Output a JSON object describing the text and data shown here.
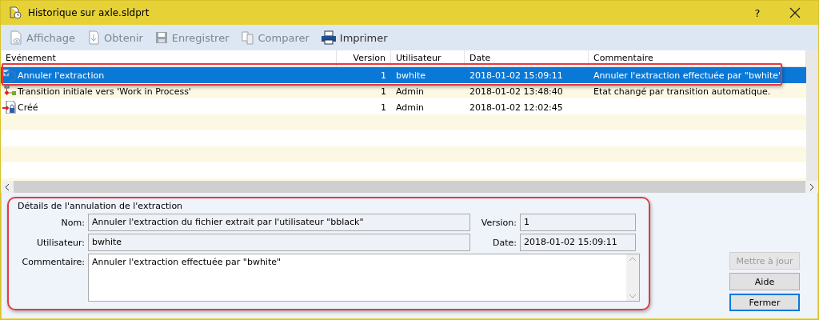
{
  "window": {
    "title": "Historique sur axle.sldprt",
    "help": "?"
  },
  "toolbar": [
    {
      "label": "Affichage",
      "kind": "view",
      "disabled": true
    },
    {
      "label": "Obtenir",
      "kind": "get",
      "disabled": true
    },
    {
      "label": "Enregistrer",
      "kind": "save",
      "disabled": true
    },
    {
      "label": "Comparer",
      "kind": "compare",
      "disabled": true
    },
    {
      "label": "Imprimer",
      "kind": "print",
      "disabled": false
    }
  ],
  "table": {
    "columns": [
      "Evénement",
      "Version",
      "Utilisateur",
      "Date",
      "Commentaire"
    ],
    "rows": [
      {
        "kind": "undo",
        "event": "Annuler l'extraction",
        "version": "1",
        "user": "bwhite",
        "date": "2018-01-02 15:09:11",
        "comment": "Annuler l'extraction effectuée par \"bwhite\"",
        "selected": true
      },
      {
        "kind": "transition",
        "event": "Transition initiale vers 'Work in Process'",
        "version": "1",
        "user": "Admin",
        "date": "2018-01-02 13:48:40",
        "comment": "Etat changé par transition automatique.",
        "selected": false
      },
      {
        "kind": "created",
        "event": "Créé",
        "version": "1",
        "user": "Admin",
        "date": "2018-01-02 12:02:45",
        "comment": "",
        "selected": false
      }
    ]
  },
  "details": {
    "title": "Détails de l'annulation de l'extraction",
    "name_label": "Nom:",
    "name": "Annuler l'extraction du fichier extrait par l'utilisateur \"bblack\"",
    "user_label": "Utilisateur:",
    "user": "bwhite",
    "comment_label": "Commentaire:",
    "comment": "Annuler l'extraction effectuée par \"bwhite\"",
    "version_label": "Version:",
    "version": "1",
    "date_label": "Date:",
    "date": "2018-01-02 15:09:11"
  },
  "buttons": [
    {
      "label": "Mettre à jour",
      "disabled": true,
      "default": false
    },
    {
      "label": "Aide",
      "disabled": false,
      "default": false
    },
    {
      "label": "Fermer",
      "disabled": false,
      "default": true
    }
  ]
}
